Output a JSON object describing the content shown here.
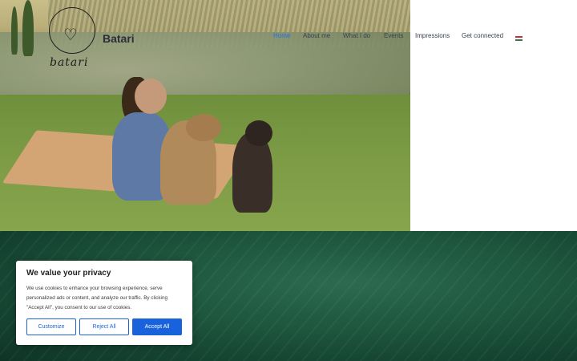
{
  "header": {
    "brand_name": "Batari",
    "logo_script": "batari",
    "nav": [
      {
        "label": "Home",
        "active": true
      },
      {
        "label": "About me",
        "active": false
      },
      {
        "label": "What I do",
        "active": false
      },
      {
        "label": "Events",
        "active": false
      },
      {
        "label": "Impressions",
        "active": false
      },
      {
        "label": "Get connected",
        "active": false
      }
    ],
    "language_flag_icon": "flag-hungary-icon"
  },
  "colors": {
    "accent": "#1a73e8",
    "button_primary": "#1863dc",
    "water": "#1f5a40"
  },
  "cookie_banner": {
    "title": "We value your privacy",
    "body": "We use cookies to enhance your browsing experience, serve personalized ads or content, and analyze our traffic. By clicking \"Accept All\", you consent to our use of cookies.",
    "customize_label": "Customize",
    "reject_label": "Reject All",
    "accept_label": "Accept All"
  }
}
